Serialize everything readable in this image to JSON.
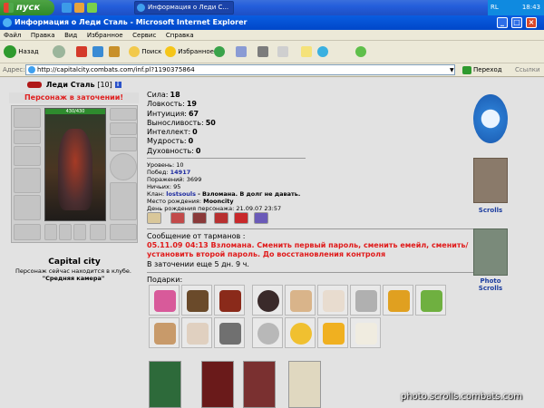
{
  "taskbar": {
    "start_label": "пуск",
    "task_title": "Информация о Леди С...",
    "tray_lang": "RL",
    "clock": "18:43"
  },
  "window": {
    "title": "Информация о Леди Сталь - Microsoft Internet Explorer"
  },
  "menu": [
    "Файл",
    "Правка",
    "Вид",
    "Избранное",
    "Сервис",
    "Справка"
  ],
  "toolbar": {
    "back_label": "Назад",
    "search_label": "Поиск",
    "favorites_label": "Избранное"
  },
  "address": {
    "label": "Адрес:",
    "url": "http://capitalcity.combats.com/inf.pl?1190375864",
    "go_label": "Переход",
    "links_label": "Ссылки"
  },
  "character": {
    "name": "Леди Сталь",
    "level": "[10]",
    "jail_banner": "Персонаж в заточении!",
    "hp": "430/430",
    "city": "Capital city",
    "location_text": "Персонаж сейчас находится в клубе.",
    "location_room": "\"Средняя камера\""
  },
  "stats": [
    {
      "label": "Сила:",
      "value": "18"
    },
    {
      "label": "Ловкость:",
      "value": "19"
    },
    {
      "label": "Интуиция:",
      "value": "67"
    },
    {
      "label": "Выносливость:",
      "value": "50"
    },
    {
      "label": "Интеллект:",
      "value": "0"
    },
    {
      "label": "Мудрость:",
      "value": "0"
    },
    {
      "label": "Духовность:",
      "value": "0"
    }
  ],
  "details": {
    "level": "Уровень: 10",
    "wins_label": "Побед:",
    "wins": "14917",
    "losses": "Поражений: 3699",
    "draws": "Ничьих: 95",
    "clan_label": "Клан:",
    "clan_name": "lostsouls",
    "clan_note": "- Взломана. В долг не давать.",
    "birthplace_label": "Место рождения:",
    "birthplace": "Mooncity",
    "birthday": "День рождения персонажа: 21.09.07 23:57"
  },
  "message": {
    "label": "Сообщение от тарманов :",
    "text": "05.11.09 04:13 Взломана. Сменить первый пароль, сменить емейл, сменить/установить второй пароль. До восстановления контроля",
    "jail_time": "В заточении еще 5 дн. 9 ч."
  },
  "gifts_label": "Подарки:",
  "sidebar": {
    "scrolls_label": "Scrolls",
    "photo_label": "Photo Scrolls"
  },
  "watermark": "photo.scrolls.combats.com",
  "colors": {
    "jail_red": "#e02020",
    "link_blue": "#1d2aa0",
    "xp_blue": "#0a5de0"
  }
}
